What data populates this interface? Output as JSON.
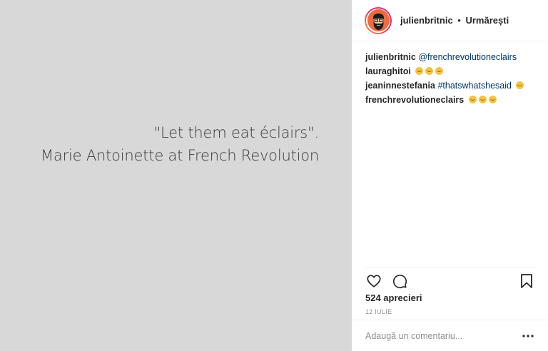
{
  "media": {
    "quote_line1": "\"Let them eat éclairs\".",
    "quote_line2": "Marie Antoinette at French Revolution",
    "background": "#d8d8d8"
  },
  "header": {
    "username": "julienbritnic",
    "separator": "•",
    "follow_label": "Urmărești",
    "avatar_icon": "bearded-man-avatar"
  },
  "comments": [
    {
      "user": "julienbritnic",
      "text_link": "@frenchrevolutioneclairs",
      "emojis": []
    },
    {
      "user": "lauraghitoi",
      "text_link": "",
      "emojis": [
        "grin-emoji",
        "grin-emoji",
        "grin-emoji"
      ]
    },
    {
      "user": "jeaninnestefania",
      "text_link": "#thatswhatshesaid",
      "emojis": [
        "laughing-emoji"
      ]
    },
    {
      "user": "frenchrevolutioneclairs",
      "text_link": "",
      "emojis": [
        "smile-emoji",
        "smile-emoji",
        "smile-emoji"
      ]
    }
  ],
  "actions": {
    "like_icon": "heart-icon",
    "comment_icon": "comment-bubble-icon",
    "save_icon": "bookmark-icon"
  },
  "likes": "524 aprecieri",
  "date": "12 IULIE",
  "comment_box": {
    "placeholder": "Adaugă un comentariu...",
    "more_icon": "ellipsis-icon"
  },
  "colors": {
    "link": "#003569",
    "muted": "#8e8e8e",
    "text": "#262626"
  }
}
